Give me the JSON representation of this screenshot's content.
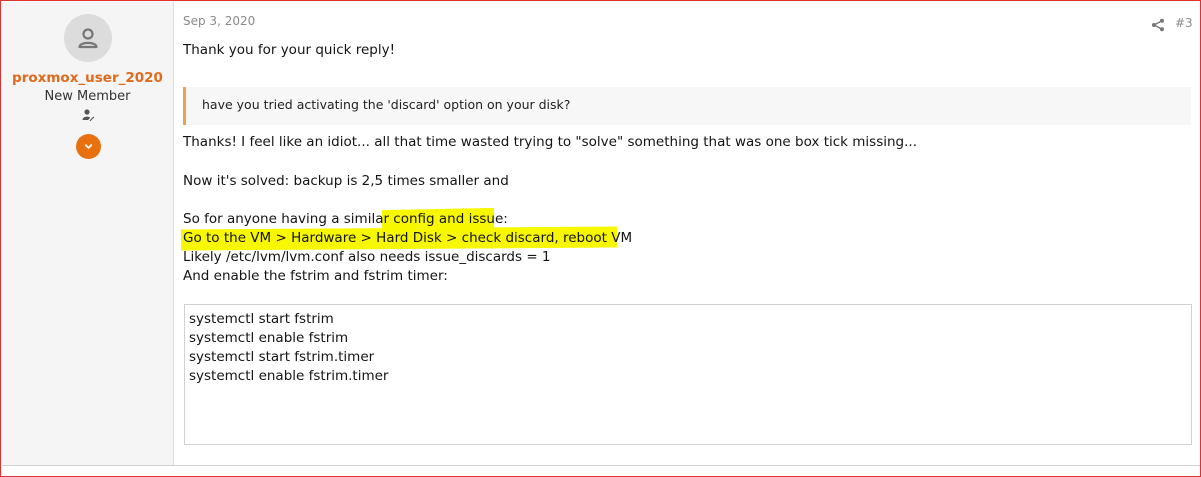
{
  "user": {
    "name": "proxmox_user_2020",
    "title": "New Member",
    "avatar_icon": "person-icon",
    "staff_icon": "user-edit-icon",
    "expand_icon": "chevron-down-icon"
  },
  "post": {
    "date": "Sep 3, 2020",
    "number": "#3",
    "share_icon": "share-icon",
    "greeting": "Thank you for your quick reply!",
    "quote": "have you tried activating the 'discard' option on your disk?",
    "lines": [
      "Thanks! I feel like an idiot... all that time wasted trying to \"solve\" something that was one box tick missing...",
      "Now it's solved: backup is 2,5 times smaller and",
      "So for anyone having a similar config and issue:",
      "Go to the VM > Hardware > Hard Disk > check discard, reboot VM",
      "Likely /etc/lvm/lvm.conf also needs issue_discards = 1",
      "And enable the fstrim and fstrim timer:"
    ],
    "code": [
      "systemctl start fstrim",
      "systemctl enable fstrim",
      "systemctl start fstrim.timer",
      "systemctl enable fstrim.timer"
    ]
  },
  "colors": {
    "username": "#e06a1b",
    "accent": "#e8700f",
    "highlight": "#f7f700",
    "border": "#e03030"
  }
}
